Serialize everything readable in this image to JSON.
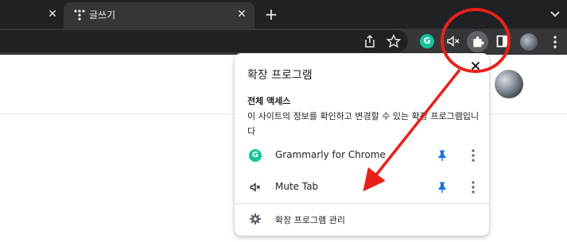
{
  "tabs": [
    {
      "title": ""
    },
    {
      "title": "글쓰기"
    }
  ],
  "icons": {
    "tab_close": "close-icon",
    "new_tab": "plus-icon",
    "tab_search": "chevron-down-icon",
    "share": "share-icon",
    "bookmark": "star-icon",
    "grammarly": "grammarly-icon",
    "mute": "mute-icon",
    "extensions": "puzzle-icon",
    "side_panel": "side-panel-icon",
    "menu": "more-vert-icon",
    "pin": "pin-icon",
    "gear": "gear-icon"
  },
  "toolbar": {
    "grammarly_glyph": "G"
  },
  "popup": {
    "title": "확장 프로그램",
    "section_title": "전체 액세스",
    "section_desc": "이 사이트의 정보를 확인하고 변경할 수 있는 확장 프로그램입니다",
    "extensions": [
      {
        "name": "Grammarly for Chrome",
        "glyph": "G"
      },
      {
        "name": "Mute Tab"
      }
    ],
    "manage_label": "확장 프로그램 관리"
  },
  "colors": {
    "tabstrip_bg": "#202124",
    "toolbar_bg": "#35363a",
    "pin_blue": "#1a73e8",
    "grammarly_green": "#15c39a",
    "annotation_red": "#e8201a"
  }
}
